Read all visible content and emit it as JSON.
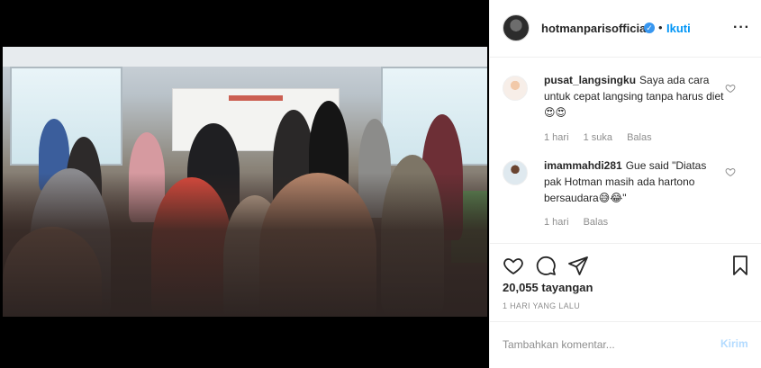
{
  "post": {
    "username": "hotmanparisofficial",
    "verified_icon": "verified-badge-icon",
    "separator": "•",
    "follow_label": "Ikuti",
    "more_icon": "more-options-icon"
  },
  "comments": [
    {
      "username": "pusat_langsingku",
      "text": "Saya ada cara untuk cepat langsing tanpa harus diet😍😍",
      "time": "1 hari",
      "likes": "1 suka",
      "reply_label": "Balas"
    },
    {
      "username": "imammahdi281",
      "text": "Gue said \"Diatas pak Hotman masih ada hartono bersaudara😅😂\"",
      "time": "1 hari",
      "reply_label": "Balas"
    }
  ],
  "actions": {
    "like_icon": "heart-icon",
    "comment_icon": "comment-icon",
    "share_icon": "share-icon",
    "save_icon": "bookmark-icon",
    "views": "20,055 tayangan",
    "time_ago": "1 HARI YANG LALU"
  },
  "add_comment": {
    "placeholder": "Tambahkan komentar...",
    "post_label": "Kirim"
  },
  "colors": {
    "accent": "#0095f6",
    "post_disabled": "#b3dbff",
    "muted": "#8e8e8e",
    "text": "#262626"
  }
}
